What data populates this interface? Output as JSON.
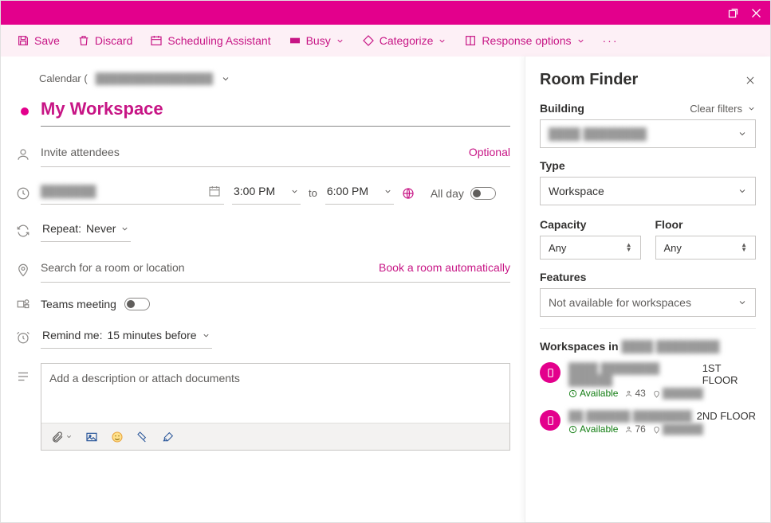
{
  "breadcrumb": {
    "text": "Calendar (",
    "account": "████████████████"
  },
  "meeting": {
    "title": "My Workspace",
    "attendees_placeholder": "Invite attendees",
    "optional_label": "Optional",
    "date": "███████",
    "start_time": "3:00 PM",
    "to_label": "to",
    "end_time": "6:00 PM",
    "all_day_label": "All day",
    "repeat_prefix": "Repeat:",
    "repeat_value": "Never",
    "location_placeholder": "Search for a room or location",
    "auto_book_label": "Book a room automatically",
    "teams_label": "Teams meeting",
    "remind_prefix": "Remind me:",
    "remind_value": "15 minutes before",
    "description_placeholder": "Add a description or attach documents"
  },
  "toolbar": {
    "save": "Save",
    "discard": "Discard",
    "scheduling": "Scheduling Assistant",
    "busy": "Busy",
    "categorize": "Categorize",
    "response": "Response options"
  },
  "roomfinder": {
    "title": "Room Finder",
    "building_label": "Building",
    "clear_label": "Clear filters",
    "building_value": "████ ████████",
    "type_label": "Type",
    "type_value": "Workspace",
    "capacity_label": "Capacity",
    "capacity_value": "Any",
    "floor_label": "Floor",
    "floor_value": "Any",
    "features_label": "Features",
    "features_value": "Not available for workspaces",
    "list_header_prefix": "Workspaces in",
    "list_header_building": "████ ████████",
    "items": [
      {
        "name_hidden": "████ ████████ ██████",
        "name_suffix": "1ST FLOOR",
        "status": "Available",
        "capacity": "43",
        "location": "██████"
      },
      {
        "name_hidden": "██ ██████ ████████",
        "name_suffix": "2ND FLOOR",
        "status": "Available",
        "capacity": "76",
        "location": "██████"
      }
    ]
  }
}
